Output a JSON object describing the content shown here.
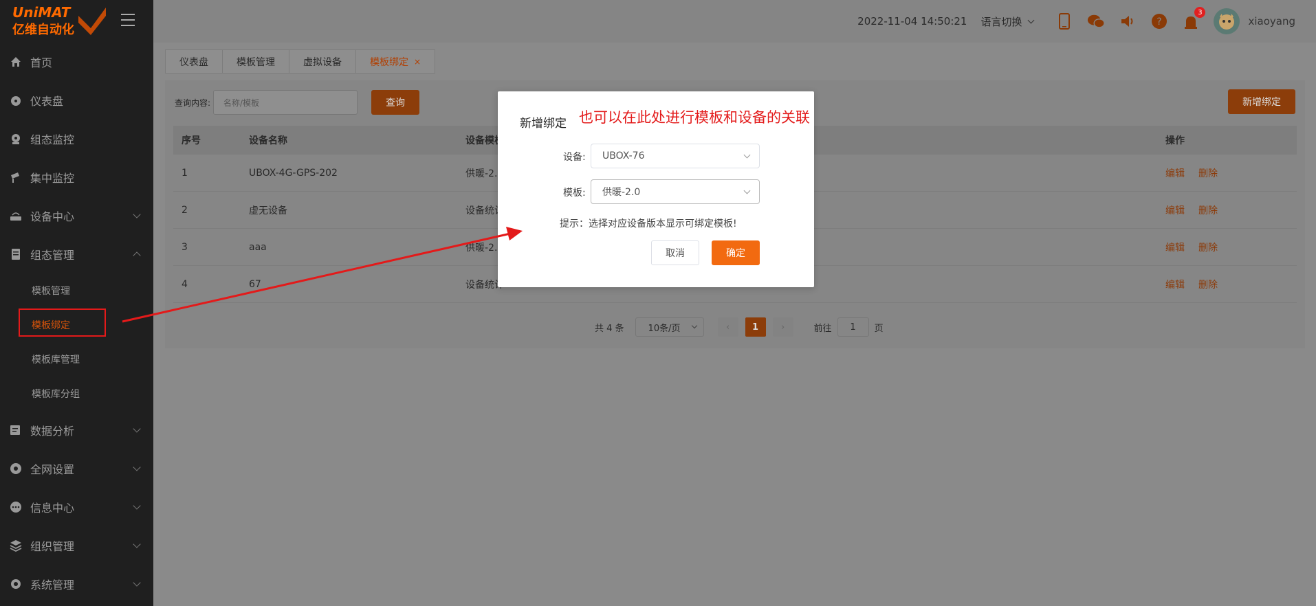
{
  "logo": {
    "text_top": "UniMAT",
    "text_bottom": "亿维自动化"
  },
  "sidebar": {
    "items": [
      {
        "label": "首页",
        "icon": "home-icon"
      },
      {
        "label": "仪表盘",
        "icon": "dashboard-icon"
      },
      {
        "label": "组态监控",
        "icon": "monitor-icon"
      },
      {
        "label": "集中监控",
        "icon": "camera-icon"
      },
      {
        "label": "设备中心",
        "icon": "router-icon"
      },
      {
        "label": "组态管理",
        "icon": "document-icon"
      },
      {
        "label": "数据分析",
        "icon": "analytics-icon"
      },
      {
        "label": "全网设置",
        "icon": "settings-icon"
      },
      {
        "label": "信息中心",
        "icon": "message-icon"
      },
      {
        "label": "组织管理",
        "icon": "layers-icon"
      },
      {
        "label": "系统管理",
        "icon": "gear-icon"
      }
    ],
    "sub_items": [
      "模板管理",
      "模板绑定",
      "模板库管理",
      "模板库分组"
    ]
  },
  "header": {
    "datetime": "2022-11-04 14:50:21",
    "language": "语言切换",
    "notification_count": "3",
    "username": "xiaoyang"
  },
  "tabs": [
    {
      "label": "仪表盘"
    },
    {
      "label": "模板管理"
    },
    {
      "label": "虚拟设备"
    },
    {
      "label": "模板绑定",
      "close": "×"
    }
  ],
  "search": {
    "label": "查询内容:",
    "placeholder": "名称/模板",
    "query_button": "查询",
    "add_button": "新增绑定"
  },
  "table": {
    "headers": [
      "序号",
      "设备名称",
      "设备模板",
      "操作"
    ],
    "rows": [
      {
        "index": "1",
        "name": "UBOX-4G-GPS-202",
        "template": "供暖-2."
      },
      {
        "index": "2",
        "name": "虚无设备",
        "template": "设备统计"
      },
      {
        "index": "3",
        "name": "aaa",
        "template": "供暖-2."
      },
      {
        "index": "4",
        "name": "67",
        "template": "设备统计"
      }
    ],
    "edit": "编辑",
    "delete": "删除"
  },
  "pagination": {
    "total": "共 4 条",
    "page_size": "10条/页",
    "prev": "‹",
    "current": "1",
    "next": "›",
    "goto_label": "前往",
    "goto_value": "1",
    "page_suffix": "页"
  },
  "modal": {
    "title": "新增绑定",
    "annotation": "也可以在此处进行模板和设备的关联",
    "device_label": "设备:",
    "device_value": "UBOX-76",
    "template_label": "模板:",
    "template_value": "供暖-2.0",
    "hint": "提示：选择对应设备版本显示可绑定模板!",
    "cancel": "取消",
    "confirm": "确定"
  },
  "colors": {
    "accent": "#f26a10",
    "annotation": "#e31a1a",
    "sidebar_bg": "#1f1f1f"
  }
}
